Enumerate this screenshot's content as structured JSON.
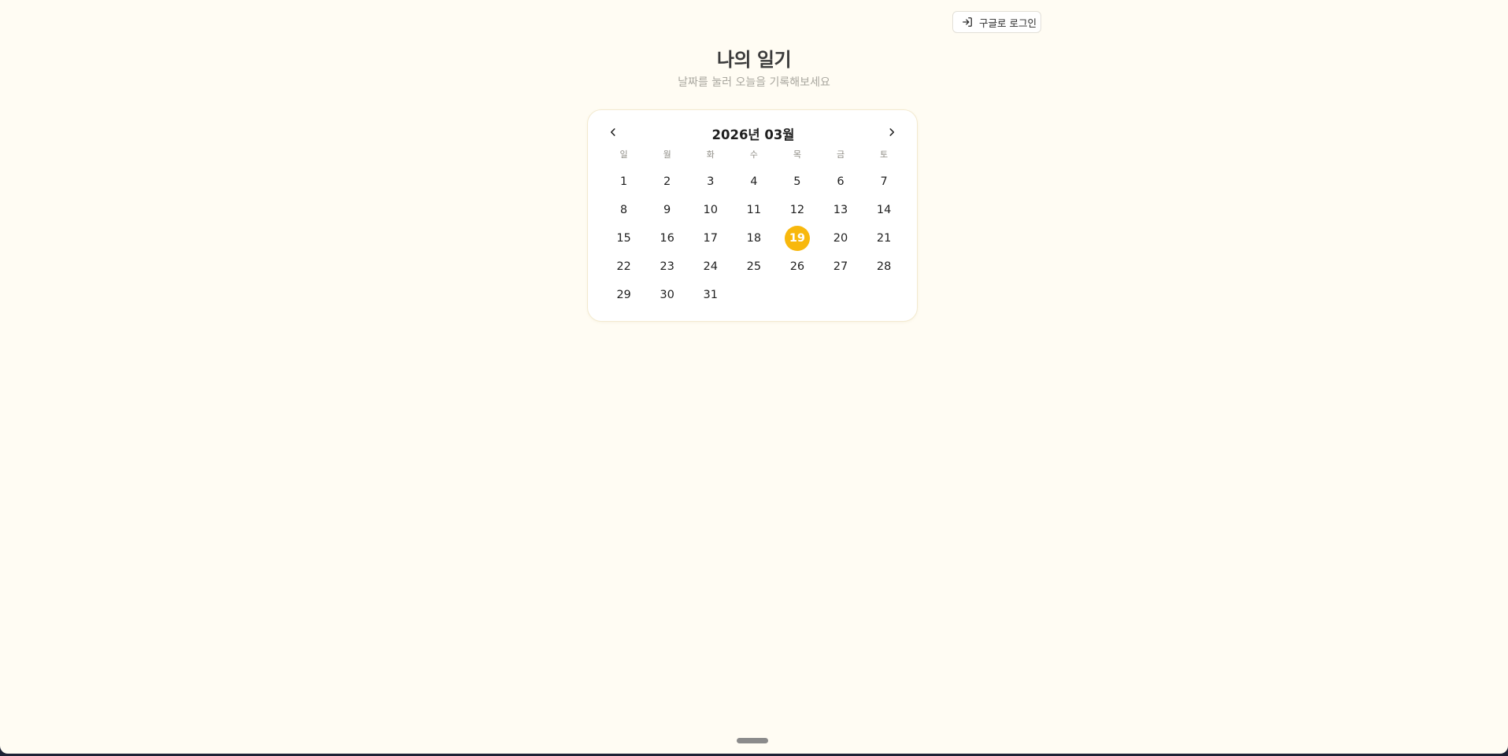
{
  "header": {
    "login_label": "구글로 로그인",
    "login_icon": "login-arrow-icon"
  },
  "page": {
    "title": "나의 일기",
    "subtitle": "날짜를 눌러 오늘을 기록해보세요"
  },
  "calendar": {
    "month_label": "2026년 03월",
    "prev_icon": "chevron-left-icon",
    "next_icon": "chevron-right-icon",
    "weekdays": [
      "일",
      "월",
      "화",
      "수",
      "목",
      "금",
      "토"
    ],
    "leading_blank_days": 0,
    "days": [
      "1",
      "2",
      "3",
      "4",
      "5",
      "6",
      "7",
      "8",
      "9",
      "10",
      "11",
      "12",
      "13",
      "14",
      "15",
      "16",
      "17",
      "18",
      "19",
      "20",
      "21",
      "22",
      "23",
      "24",
      "25",
      "26",
      "27",
      "28",
      "29",
      "30",
      "31"
    ],
    "selected_day": "19",
    "selected_color": "#f8b80d"
  },
  "colors": {
    "background": "#fffcf3",
    "accent": "#f8b80d",
    "text": "#1f1f1f",
    "muted": "#a9a79f"
  }
}
